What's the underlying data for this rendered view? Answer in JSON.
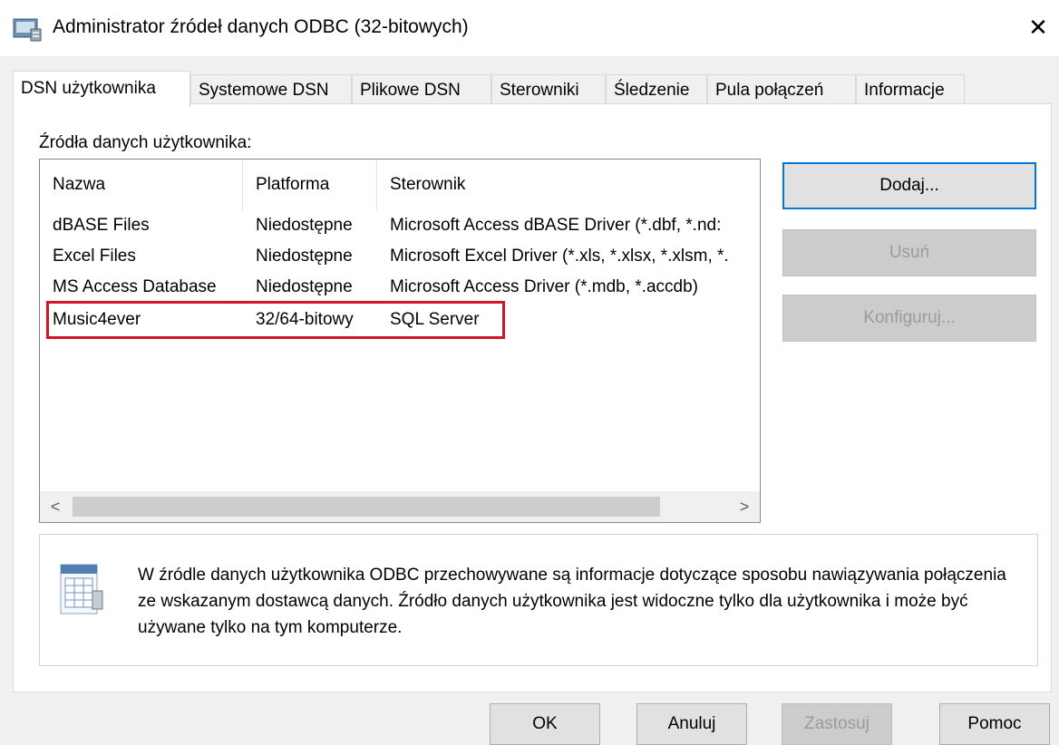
{
  "window": {
    "title": "Administrator źródeł danych ODBC (32-bitowych)",
    "close_glyph": "✕"
  },
  "tabs": [
    {
      "label": "DSN użytkownika",
      "active": true
    },
    {
      "label": "Systemowe DSN",
      "active": false
    },
    {
      "label": "Plikowe DSN",
      "active": false
    },
    {
      "label": "Sterowniki",
      "active": false
    },
    {
      "label": "Śledzenie",
      "active": false
    },
    {
      "label": "Pula połączeń",
      "active": false
    },
    {
      "label": "Informacje",
      "active": false
    }
  ],
  "panel": {
    "section_label": "Źródła danych użytkownika:",
    "columns": [
      "Nazwa",
      "Platforma",
      "Sterownik"
    ],
    "rows": [
      [
        "dBASE Files",
        "Niedostępne",
        "Microsoft Access dBASE Driver (*.dbf, *.nd:"
      ],
      [
        "Excel Files",
        "Niedostępne",
        "Microsoft Excel Driver (*.xls, *.xlsx, *.xlsm, *."
      ],
      [
        "MS Access Database",
        "Niedostępne",
        "Microsoft Access Driver (*.mdb, *.accdb)"
      ],
      [
        "Music4ever",
        "32/64-bitowy",
        "SQL Server"
      ]
    ],
    "scroll_left": "<",
    "scroll_right": ">",
    "buttons": {
      "add": "Dodaj...",
      "remove": "Usuń",
      "configure": "Konfiguruj..."
    },
    "info_text": "W źródle danych użytkownika ODBC przechowywane są informacje dotyczące sposobu nawiązywania połączenia ze wskazanym dostawcą danych. Źródło danych użytkownika jest widoczne tylko dla użytkownika i może być używane tylko na tym komputerze."
  },
  "footer": {
    "ok": "OK",
    "cancel": "Anuluj",
    "apply": "Zastosuj",
    "help": "Pomoc"
  },
  "colors": {
    "highlight_border": "#d0142c",
    "focus_border": "#0078d7"
  }
}
